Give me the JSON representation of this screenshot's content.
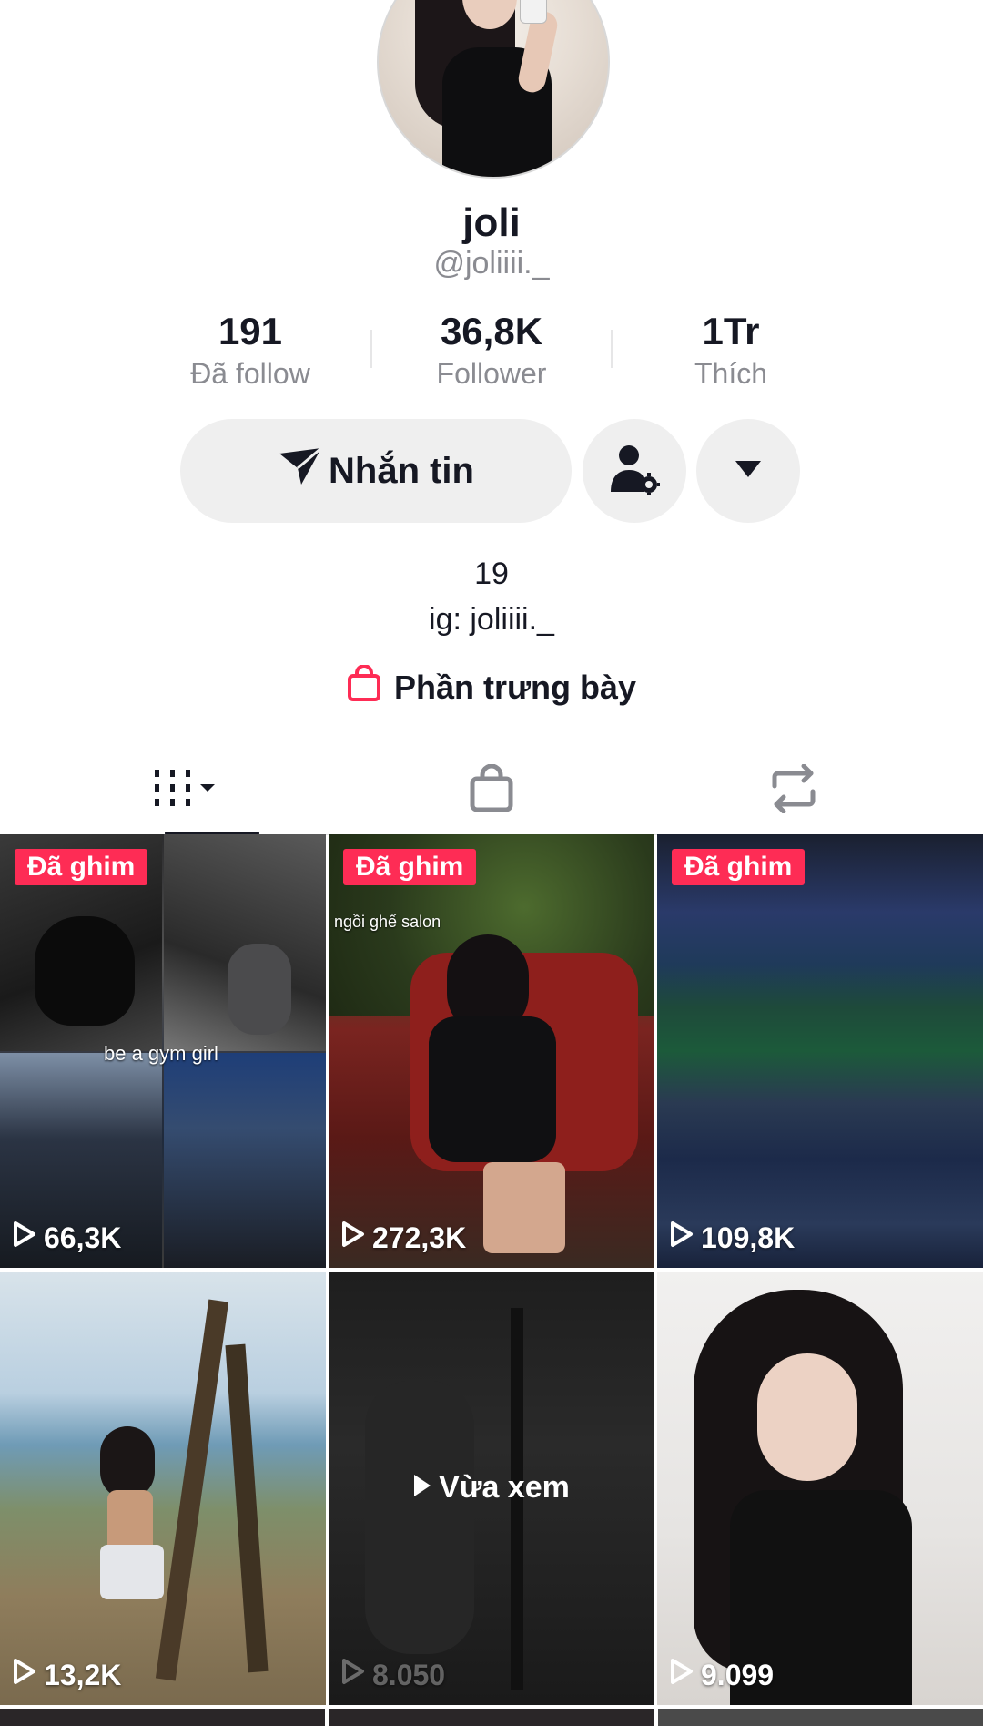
{
  "profile": {
    "display_name": "joli",
    "username": "@joliiii._"
  },
  "stats": [
    {
      "value": "191",
      "label": "Đã follow"
    },
    {
      "value": "36,8K",
      "label": "Follower"
    },
    {
      "value": "1Tr",
      "label": "Thích"
    }
  ],
  "actions": {
    "message_label": "Nhắn tin",
    "message_icon": "send-icon",
    "friends_icon": "user-settings-icon",
    "more_icon": "caret-down-icon"
  },
  "bio": {
    "line1": "19",
    "line2": "ig: joliiii._"
  },
  "showcase": {
    "label": "Phần trưng bày",
    "icon": "shopping-bag-icon",
    "icon_color": "#fe2c55"
  },
  "tabs": [
    {
      "name": "videos-tab",
      "icon": "grid-dropdown-icon",
      "active": true
    },
    {
      "name": "shop-tab",
      "icon": "shopping-bag-icon",
      "active": false
    },
    {
      "name": "reposts-tab",
      "icon": "repost-icon",
      "active": false
    }
  ],
  "videos": [
    {
      "pinned_label": "Đã ghim",
      "caption": "be a gym girl",
      "views": "66,3K"
    },
    {
      "pinned_label": "Đã ghim",
      "caption": "ngồi ghế salon",
      "views": "272,3K"
    },
    {
      "pinned_label": "Đã ghim",
      "views": "109,8K"
    },
    {
      "views": "13,2K"
    },
    {
      "watched_label": "Vừa xem",
      "views": "8.050"
    },
    {
      "views": "9.099"
    }
  ],
  "colors": {
    "accent": "#fe2c55",
    "text_primary": "#161823",
    "text_secondary": "#8a8b91",
    "button_bg": "#efefef"
  }
}
